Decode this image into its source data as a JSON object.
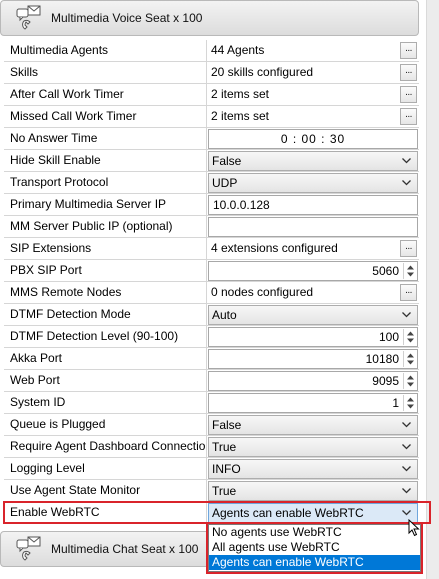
{
  "sections": {
    "voice_title": "Multimedia Voice Seat x 100",
    "chat_title": "Multimedia Chat Seat x 100"
  },
  "properties": [
    {
      "label": "Multimedia Agents",
      "value": "44 Agents",
      "control": "ellipsis"
    },
    {
      "label": "Skills",
      "value": "20 skills configured",
      "control": "ellipsis"
    },
    {
      "label": "After Call Work Timer",
      "value": "2 items set",
      "control": "ellipsis"
    },
    {
      "label": "Missed Call Work Timer",
      "value": "2 items set",
      "control": "ellipsis"
    },
    {
      "label": "No Answer Time",
      "value": "0 : 00 : 30",
      "control": "time"
    },
    {
      "label": "Hide Skill Enable",
      "value": "False",
      "control": "dropdown"
    },
    {
      "label": "Transport Protocol",
      "value": "UDP",
      "control": "dropdown"
    },
    {
      "label": "Primary Multimedia Server IP",
      "value": "10.0.0.128",
      "control": "text"
    },
    {
      "label": "MM Server Public IP (optional)",
      "value": "",
      "control": "text"
    },
    {
      "label": "SIP Extensions",
      "value": "4 extensions configured",
      "control": "ellipsis"
    },
    {
      "label": "PBX SIP Port",
      "value": "5060",
      "control": "number"
    },
    {
      "label": "MMS Remote Nodes",
      "value": "0 nodes configured",
      "control": "ellipsis"
    },
    {
      "label": "DTMF Detection Mode",
      "value": "Auto",
      "control": "dropdown"
    },
    {
      "label": "DTMF Detection Level (90-100)",
      "value": "100",
      "control": "number"
    },
    {
      "label": "Akka Port",
      "value": "10180",
      "control": "number"
    },
    {
      "label": "Web Port",
      "value": "9095",
      "control": "number"
    },
    {
      "label": "System ID",
      "value": "1",
      "control": "number"
    },
    {
      "label": "Queue is Plugged",
      "value": "False",
      "control": "dropdown"
    },
    {
      "label": "Require Agent Dashboard Connection",
      "value": "True",
      "control": "dropdown"
    },
    {
      "label": "Logging Level",
      "value": "INFO",
      "control": "dropdown"
    },
    {
      "label": "Use Agent State Monitor",
      "value": "True",
      "control": "dropdown"
    },
    {
      "label": "Enable WebRTC",
      "value": "Agents can enable WebRTC",
      "control": "dropdown"
    }
  ],
  "webrtc_options": [
    {
      "label": "No agents use WebRTC",
      "selected": false
    },
    {
      "label": "All agents use WebRTC",
      "selected": false
    },
    {
      "label": "Agents can enable WebRTC",
      "selected": true
    }
  ],
  "ellipsis_label": "...",
  "colors": {
    "highlight": "#d9242b",
    "selection": "#0078d7"
  }
}
